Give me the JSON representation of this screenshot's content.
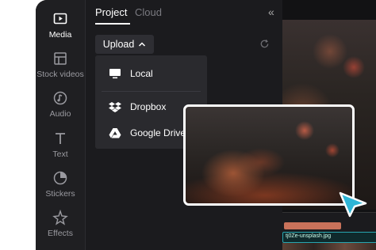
{
  "rail": {
    "items": [
      {
        "label": "Media",
        "icon": "media-icon",
        "active": true
      },
      {
        "label": "Stock videos",
        "icon": "stock-videos-icon"
      },
      {
        "label": "Audio",
        "icon": "audio-icon"
      },
      {
        "label": "Text",
        "icon": "text-icon"
      },
      {
        "label": "Stickers",
        "icon": "stickers-icon"
      },
      {
        "label": "Effects",
        "icon": "effects-icon"
      }
    ]
  },
  "panel": {
    "tabs": [
      {
        "label": "Project",
        "active": true
      },
      {
        "label": "Cloud"
      }
    ],
    "collapse_icon": "double-chevron-left-icon",
    "upload_label": "Upload",
    "refresh_icon": "refresh-icon"
  },
  "upload_menu": {
    "items": [
      {
        "label": "Local",
        "icon": "monitor-icon"
      },
      {
        "label": "Dropbox",
        "icon": "dropbox-icon"
      },
      {
        "label": "Google Drive",
        "icon": "google-drive-icon"
      }
    ]
  },
  "timeline": {
    "clip_name": "tj0Ze-unsplash.jpg"
  },
  "colors": {
    "app_bg": "#1b1b1e",
    "accent_cursor": "#2fb5d6",
    "timeline_orange": "#c9725a",
    "timeline_teal": "#27a6b0"
  }
}
